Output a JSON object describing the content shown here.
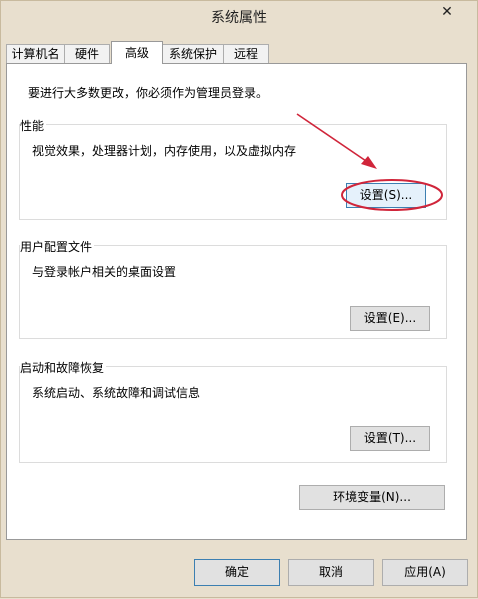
{
  "window": {
    "title": "系统属性",
    "close_glyph": "✕"
  },
  "tabs": [
    {
      "label": "计算机名",
      "active": false
    },
    {
      "label": "硬件",
      "active": false
    },
    {
      "label": "高级",
      "active": true
    },
    {
      "label": "系统保护",
      "active": false
    },
    {
      "label": "远程",
      "active": false
    }
  ],
  "advanced": {
    "notice": "要进行大多数更改，你必须作为管理员登录。",
    "performance": {
      "title": "性能",
      "description": "视觉效果，处理器计划，内存使用，以及虚拟内存",
      "button": "设置(S)..."
    },
    "user_profiles": {
      "title": "用户配置文件",
      "description": "与登录帐户相关的桌面设置",
      "button": "设置(E)..."
    },
    "startup_recovery": {
      "title": "启动和故障恢复",
      "description": "系统启动、系统故障和调试信息",
      "button": "设置(T)..."
    },
    "env_button": "环境变量(N)..."
  },
  "footer": {
    "ok": "确定",
    "cancel": "取消",
    "apply": "应用(A)"
  },
  "colors": {
    "window_bg": "#e8dfce",
    "panel_bg": "#ffffff",
    "annotation": "#d0253a"
  },
  "icons": {
    "close": "close-icon"
  }
}
